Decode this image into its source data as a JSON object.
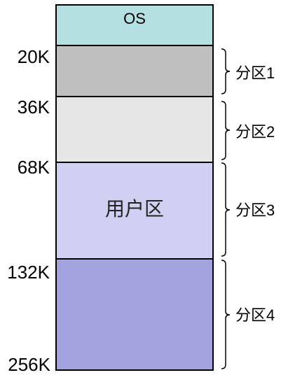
{
  "blocks": {
    "os": {
      "label": "OS"
    },
    "user_area": {
      "label": "用户区"
    }
  },
  "colors": {
    "os": "#b4e0e1",
    "partition_1": "#bfbfbf",
    "partition_2": "#e6e6e6",
    "partition_3": "#d0d1f2",
    "partition_4": "#a3a3df"
  },
  "addresses": [
    "20K",
    "36K",
    "68K",
    "132K",
    "256K"
  ],
  "partitions": [
    "分区1",
    "分区2",
    "分区3",
    "分区4"
  ]
}
